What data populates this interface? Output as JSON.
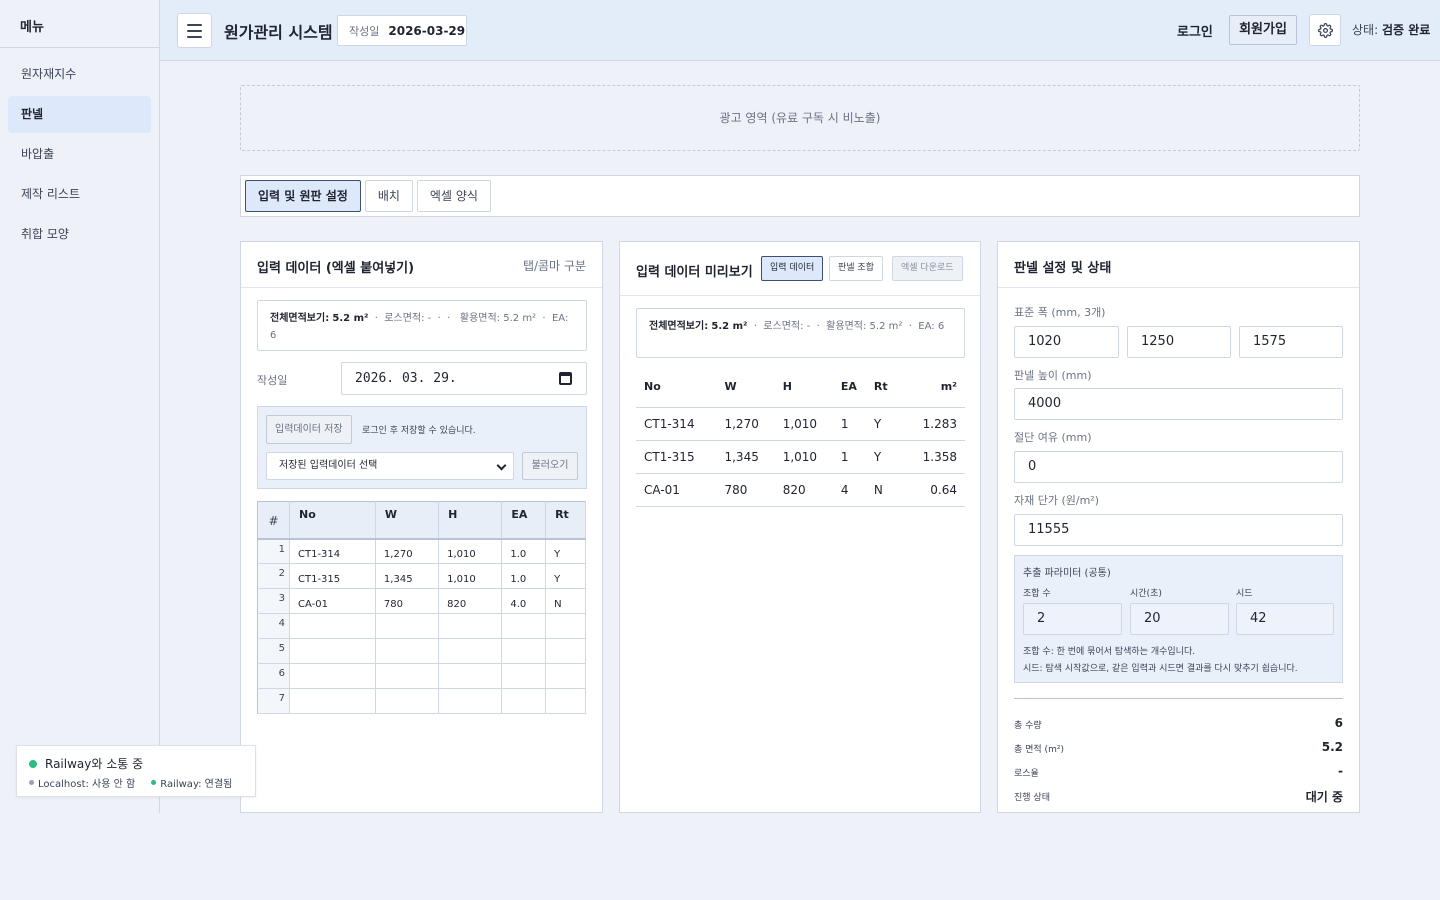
{
  "sidebar": {
    "title": "메뉴",
    "items": [
      {
        "label": "원자재지수",
        "active": false
      },
      {
        "label": "판넬",
        "active": true
      },
      {
        "label": "바압출",
        "active": false
      },
      {
        "label": "제작 리스트",
        "active": false
      },
      {
        "label": "취합 모양",
        "active": false
      }
    ]
  },
  "header": {
    "title": "원가관리 시스템",
    "date_label": "작성일",
    "date_value": "2026-03-29",
    "login": "로그인",
    "signup": "회원가입",
    "status_label": "상태:",
    "status_value": "검증 완료"
  },
  "ad": {
    "text": "광고 영역 (유료 구독 시 비노출)"
  },
  "tabs": [
    {
      "label": "입력 및 원판 설정",
      "active": true
    },
    {
      "label": "배치",
      "active": false
    },
    {
      "label": "엑셀 양식",
      "active": false
    }
  ],
  "input_panel": {
    "title": "입력 데이터 (엑셀 붙여넣기)",
    "note": "탭/콤마 구분",
    "summary": {
      "total_label": "전체면적보기:",
      "total_value": "5.2 m²",
      "loss_label": "로스면적:",
      "loss_value": "-",
      "used_label": "활용면적:",
      "used_value": "5.2 m²",
      "ea_label": "EA:",
      "ea_value": "6"
    },
    "date_label": "작성일",
    "date_value": "2026. 03. 29.",
    "save_button": "입력데이터 저장",
    "save_note": "로그인 후 저장할 수 있습니다.",
    "saved_select": "저장된 입력데이터 선택",
    "load_button": "불러오기",
    "sheet_headers": [
      "#",
      "No",
      "W",
      "H",
      "EA",
      "Rt"
    ],
    "rows": [
      {
        "n": "1",
        "no": "CT1-314",
        "w": "1,270",
        "h": "1,010",
        "ea": "1.0",
        "rt": "Y"
      },
      {
        "n": "2",
        "no": "CT1-315",
        "w": "1,345",
        "h": "1,010",
        "ea": "1.0",
        "rt": "Y"
      },
      {
        "n": "3",
        "no": "CA-01",
        "w": "780",
        "h": "820",
        "ea": "4.0",
        "rt": "N"
      },
      {
        "n": "4",
        "no": "",
        "w": "",
        "h": "",
        "ea": "",
        "rt": ""
      },
      {
        "n": "5",
        "no": "",
        "w": "",
        "h": "",
        "ea": "",
        "rt": ""
      },
      {
        "n": "6",
        "no": "",
        "w": "",
        "h": "",
        "ea": "",
        "rt": ""
      },
      {
        "n": "7",
        "no": "",
        "w": "",
        "h": "",
        "ea": "",
        "rt": ""
      }
    ]
  },
  "preview_panel": {
    "title": "입력 데이터 미리보기",
    "btn_input": "입력 데이터",
    "btn_combo": "판넬 조합",
    "btn_excel": "엑셀 다운로드",
    "headers": [
      "No",
      "W",
      "H",
      "EA",
      "Rt",
      "m²"
    ],
    "rows": [
      {
        "no": "CT1-314",
        "w": "1,270",
        "h": "1,010",
        "ea": "1",
        "rt": "Y",
        "m2": "1.283"
      },
      {
        "no": "CT1-315",
        "w": "1,345",
        "h": "1,010",
        "ea": "1",
        "rt": "Y",
        "m2": "1.358"
      },
      {
        "no": "CA-01",
        "w": "780",
        "h": "820",
        "ea": "4",
        "rt": "N",
        "m2": "0.64"
      }
    ]
  },
  "settings_panel": {
    "title": "판넬 설정 및 상태",
    "std_width_label": "표준 폭 (mm, 3개)",
    "std_widths": [
      "1020",
      "1250",
      "1575"
    ],
    "height_label": "판넬 높이 (mm)",
    "height_value": "4000",
    "margin_label": "절단 여유 (mm)",
    "margin_value": "0",
    "price_label": "자재 단가 (원/m²)",
    "price_value": "11555",
    "params": {
      "title": "추출 파라미터 (공통)",
      "combo_label": "조합 수",
      "combo_value": "2",
      "time_label": "시간(초)",
      "time_value": "20",
      "seed_label": "시드",
      "seed_value": "42",
      "hint1": "조합 수: 한 번에 묶어서 탐색하는 개수입니다.",
      "hint2": "시드: 탐색 시작값으로, 같은 입력과 시드면 결과를 다시 맞추기 쉽습니다."
    },
    "stats": [
      {
        "label": "총 수량",
        "value": "6"
      },
      {
        "label": "총 면적 (m²)",
        "value": "5.2"
      },
      {
        "label": "로스율",
        "value": "-"
      },
      {
        "label": "진행 상태",
        "value": "대기 중"
      }
    ]
  },
  "connection": {
    "main": "Railway와 소통 중",
    "localhost": "Localhost: 사용 안 함",
    "railway": "Railway: 연결됨"
  }
}
